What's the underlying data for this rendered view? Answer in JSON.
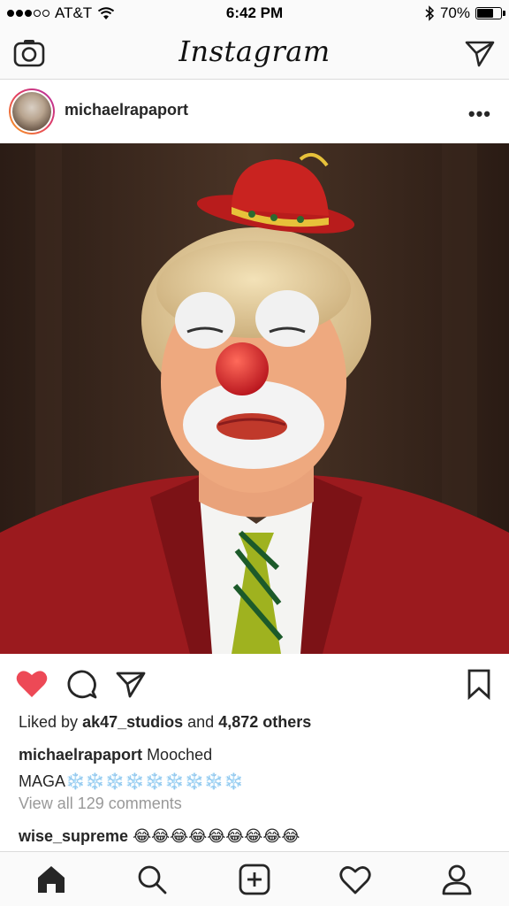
{
  "status_bar": {
    "carrier": "AT&T",
    "time": "6:42 PM",
    "battery": "70%",
    "battery_level": 0.7,
    "signal_bars": 3
  },
  "nav": {
    "logo": "Instagram",
    "left_icon": "camera-icon",
    "right_icon": "direct-message-icon"
  },
  "post": {
    "username": "michaelrapaport",
    "more": "•••",
    "likes_prefix": "Liked by",
    "liked_by_user": "ak47_studios",
    "likes_and": "and",
    "likes_others": "4,872 others",
    "caption_user": "michaelrapaport",
    "caption_line1": "Mooched",
    "caption_line2": "MAGA❄️❄️❄️❄️❄️❄️❄️❄️❄️",
    "view_comments": "View all 129 comments",
    "comment_user": "wise_supreme",
    "comment_text": "😂😂😂😂😂😂😂😂😂",
    "liked": true
  },
  "tabs": [
    "home-icon",
    "search-icon",
    "add-post-icon",
    "activity-heart-icon",
    "profile-icon"
  ],
  "colors": {
    "like_red": "#ed4956",
    "text": "#262626",
    "muted": "#999999",
    "bar_bg": "#fafafa",
    "divider": "#dbdbdb"
  }
}
